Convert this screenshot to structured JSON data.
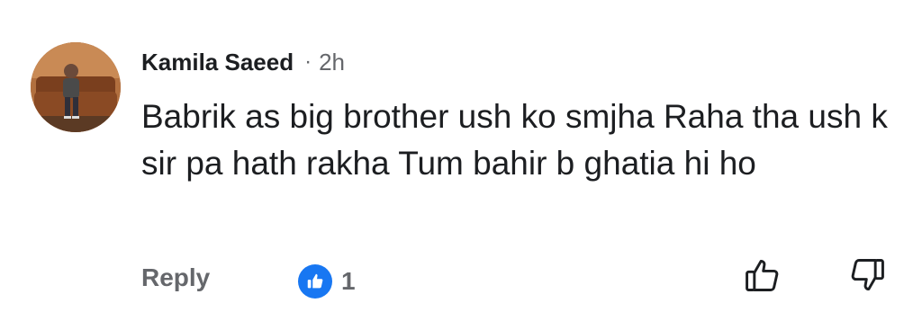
{
  "comment": {
    "author": "Kamila Saeed",
    "separator": "·",
    "time": "2h",
    "text": "Babrik as big brother ush ko smjha Raha tha ush k sir pa hath rakha Tum bahir b ghatia hi ho",
    "reply_label": "Reply",
    "reaction": {
      "icon": "like-icon",
      "count": "1"
    }
  },
  "actions": {
    "like_icon": "thumbs-up-outline-icon",
    "dislike_icon": "thumbs-down-outline-icon"
  },
  "colors": {
    "text_primary": "#1c1e21",
    "text_secondary": "#65676b",
    "like_blue": "#1877f2",
    "background": "#ffffff"
  }
}
